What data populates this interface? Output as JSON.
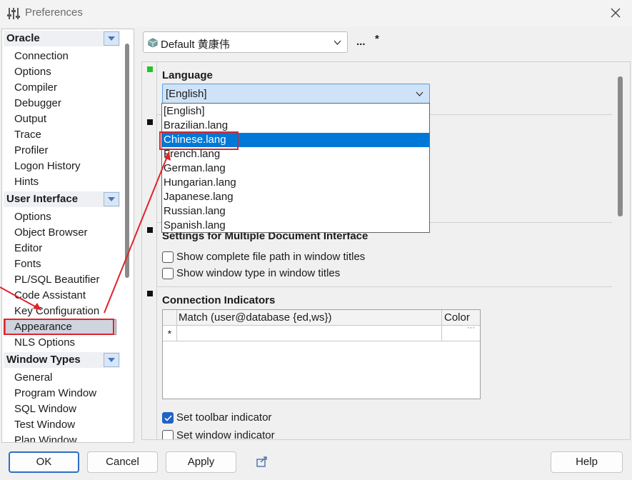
{
  "window": {
    "title": "Preferences",
    "icon": "sliders-icon",
    "close_icon": "close-icon"
  },
  "tree": {
    "groups": [
      {
        "label": "Oracle",
        "items": [
          "Connection",
          "Options",
          "Compiler",
          "Debugger",
          "Output",
          "Trace",
          "Profiler",
          "Logon History",
          "Hints"
        ]
      },
      {
        "label": "User Interface",
        "items": [
          "Options",
          "Object Browser",
          "Editor",
          "Fonts",
          "PL/SQL Beautifier",
          "Code Assistant",
          "Key Configuration",
          "Appearance",
          "NLS Options"
        ]
      },
      {
        "label": "Window Types",
        "items": [
          "General",
          "Program Window",
          "SQL Window",
          "Test Window",
          "Plan Window"
        ]
      }
    ],
    "selected": "Appearance"
  },
  "profile": {
    "value": "Default 黄康伟",
    "more": "...",
    "modified": "*"
  },
  "language": {
    "title": "Language",
    "value": "[English]",
    "options": [
      "[English]",
      "Brazilian.lang",
      "Chinese.lang",
      "French.lang",
      "German.lang",
      "Hungarian.lang",
      "Japanese.lang",
      "Russian.lang",
      "Spanish.lang"
    ],
    "highlighted": "Chinese.lang"
  },
  "mdi": {
    "title": "Settings for Multiple Document Interface",
    "show_path": {
      "label": "Show complete file path in window titles",
      "checked": false
    },
    "show_type": {
      "label": "Show window type in window titles",
      "checked": false
    }
  },
  "connection": {
    "title": "Connection Indicators",
    "columns": [
      "Match (user@database {ed,ws})",
      "Color"
    ],
    "new_row_marker": "*",
    "ellipsis": "···",
    "toolbar_indicator": {
      "label": "Set toolbar indicator",
      "checked": true
    },
    "window_indicator": {
      "label": "Set window indicator",
      "checked": false
    }
  },
  "buttons": {
    "ok": "OK",
    "cancel": "Cancel",
    "apply": "Apply",
    "help": "Help"
  },
  "colors": {
    "accent": "#0078d7",
    "annotation": "#e0232b",
    "marker_active": "#22c42a"
  }
}
